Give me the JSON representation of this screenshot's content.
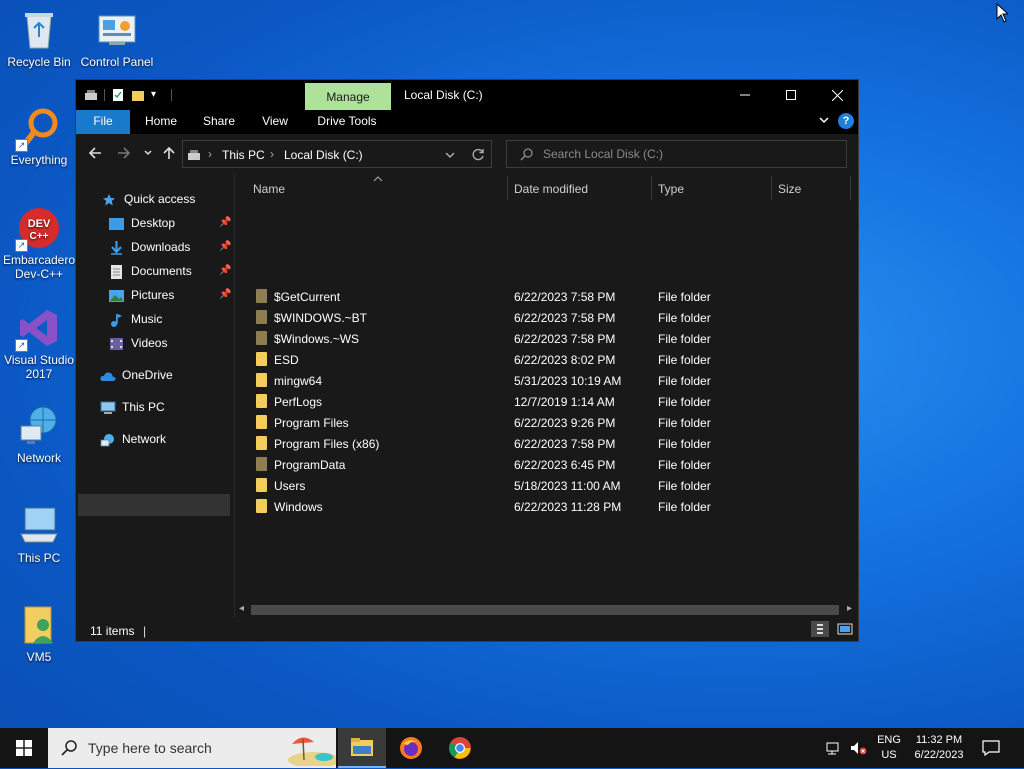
{
  "desktop": {
    "icons": [
      {
        "label": "Recycle Bin"
      },
      {
        "label": "Control Panel"
      },
      {
        "label": "Everything"
      },
      {
        "label": "Embarcadero Dev-C++"
      },
      {
        "label": "Visual Studio 2017"
      },
      {
        "label": "Network"
      },
      {
        "label": "This PC"
      },
      {
        "label": "VM5"
      }
    ]
  },
  "window": {
    "title": "Local Disk (C:)",
    "contextual_tab": "Manage",
    "ribbon_tabs": [
      "File",
      "Home",
      "Share",
      "View",
      "Drive Tools"
    ],
    "address": {
      "root": "This PC",
      "current": "Local Disk (C:)"
    },
    "search_placeholder": "Search Local Disk (C:)",
    "nav": {
      "quick_access": "Quick access",
      "items": [
        "Desktop",
        "Downloads",
        "Documents",
        "Pictures",
        "Music",
        "Videos"
      ],
      "onedrive": "OneDrive",
      "this_pc": "This PC",
      "network": "Network"
    },
    "columns": [
      "Name",
      "Date modified",
      "Type",
      "Size"
    ],
    "rows": [
      {
        "name": "$GetCurrent",
        "date": "6/22/2023 7:58 PM",
        "type": "File folder"
      },
      {
        "name": "$WINDOWS.~BT",
        "date": "6/22/2023 7:58 PM",
        "type": "File folder"
      },
      {
        "name": "$Windows.~WS",
        "date": "6/22/2023 7:58 PM",
        "type": "File folder"
      },
      {
        "name": "ESD",
        "date": "6/22/2023 8:02 PM",
        "type": "File folder"
      },
      {
        "name": "mingw64",
        "date": "5/31/2023 10:19 AM",
        "type": "File folder"
      },
      {
        "name": "PerfLogs",
        "date": "12/7/2019 1:14 AM",
        "type": "File folder"
      },
      {
        "name": "Program Files",
        "date": "6/22/2023 9:26 PM",
        "type": "File folder"
      },
      {
        "name": "Program Files (x86)",
        "date": "6/22/2023 7:58 PM",
        "type": "File folder"
      },
      {
        "name": "ProgramData",
        "date": "6/22/2023 6:45 PM",
        "type": "File folder"
      },
      {
        "name": "Users",
        "date": "5/18/2023 11:00 AM",
        "type": "File folder"
      },
      {
        "name": "Windows",
        "date": "6/22/2023 11:28 PM",
        "type": "File folder"
      }
    ],
    "status": "11 items"
  },
  "taskbar": {
    "search_placeholder": "Type here to search",
    "lang_top": "ENG",
    "lang_bottom": "US",
    "time": "11:32 PM",
    "date": "6/22/2023"
  },
  "colors": {
    "ribbon_file": "#1979ca",
    "manage_tab": "#aee29a",
    "window_bg": "#191919",
    "folder": "#f2cd5c"
  }
}
